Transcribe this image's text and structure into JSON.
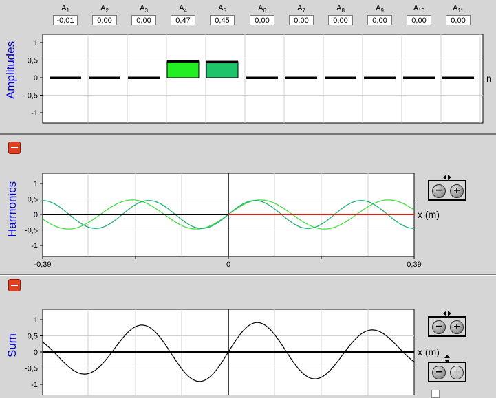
{
  "amplitudes": {
    "inputs": [
      {
        "sym": "A",
        "sub": "1",
        "value": "-0,01",
        "v": -0.01
      },
      {
        "sym": "A",
        "sub": "2",
        "value": "0,00",
        "v": 0
      },
      {
        "sym": "A",
        "sub": "3",
        "value": "0,00",
        "v": 0
      },
      {
        "sym": "A",
        "sub": "4",
        "value": "0,47",
        "v": 0.47
      },
      {
        "sym": "A",
        "sub": "5",
        "value": "0,45",
        "v": 0.45
      },
      {
        "sym": "A",
        "sub": "6",
        "value": "0,00",
        "v": 0
      },
      {
        "sym": "A",
        "sub": "7",
        "value": "0,00",
        "v": 0
      },
      {
        "sym": "A",
        "sub": "8",
        "value": "0,00",
        "v": 0
      },
      {
        "sym": "A",
        "sub": "9",
        "value": "0,00",
        "v": 0
      },
      {
        "sym": "A",
        "sub": "10",
        "value": "0,00",
        "v": 0
      },
      {
        "sym": "A",
        "sub": "11",
        "value": "0,00",
        "v": 0
      }
    ],
    "panel_label": "Amplitudes",
    "x_unit": "n",
    "y_ticks": [
      "1",
      "0,5",
      "0",
      "-0,5",
      "-1"
    ],
    "bar_colors": {
      "A4": "#22ee22",
      "A5": "#1fc36a",
      "neutral": "#000000"
    }
  },
  "harmonics": {
    "panel_label": "Harmonics",
    "x_unit": "x (m)",
    "y_ticks": [
      "1",
      "0,5",
      "0",
      "-0,5",
      "-1"
    ],
    "x_ticks": [
      "-0,39",
      "0",
      "0,39"
    ],
    "colors": {
      "harmonic4": "#44dd44",
      "harmonic5": "#20b070",
      "zero_line": "#cc2222"
    }
  },
  "sum": {
    "panel_label": "Sum",
    "x_unit": "x (m)",
    "y_ticks": [
      "1",
      "0,5",
      "0",
      "-0,5",
      "-1"
    ]
  },
  "colors": {
    "panel_label": "#0000cc",
    "background": "#d6d6d6"
  }
}
